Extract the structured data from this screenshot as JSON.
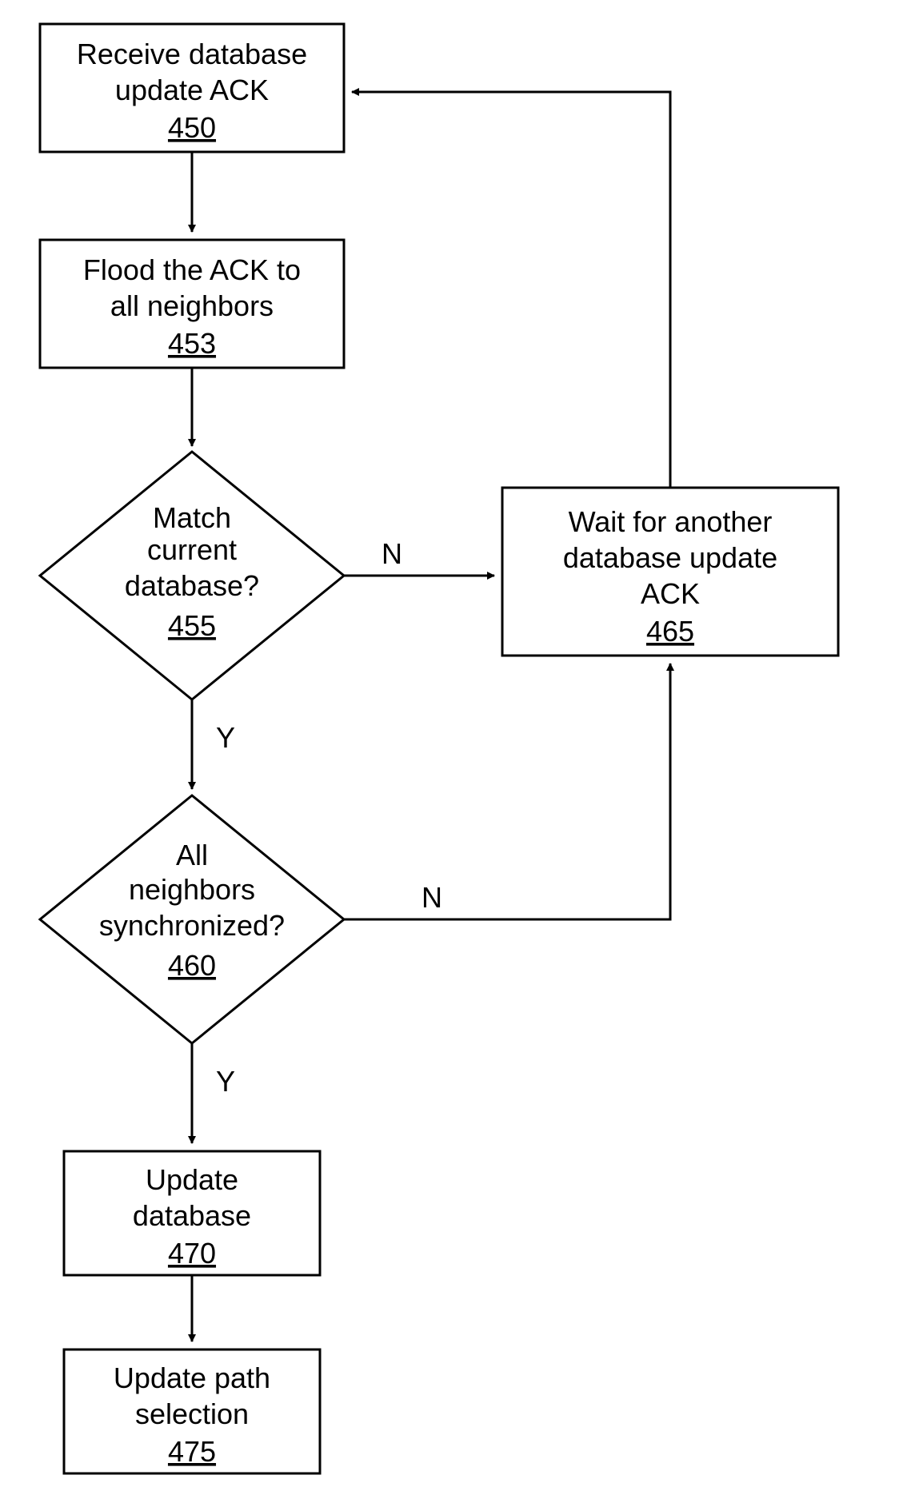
{
  "nodes": {
    "n450": {
      "line1": "Receive database",
      "line2": "update ACK",
      "num": "450"
    },
    "n453": {
      "line1": "Flood the ACK to",
      "line2": "all neighbors",
      "num": "453"
    },
    "n455": {
      "line1": "Match",
      "line2": "current",
      "line3": "database?",
      "num": "455"
    },
    "n460": {
      "line1": "All",
      "line2": "neighbors",
      "line3": "synchronized?",
      "num": "460"
    },
    "n465": {
      "line1": "Wait for another",
      "line2": "database update",
      "line3": "ACK",
      "num": "465"
    },
    "n470": {
      "line1": "Update",
      "line2": "database",
      "num": "470"
    },
    "n475": {
      "line1": "Update path",
      "line2": "selection",
      "num": "475"
    }
  },
  "labels": {
    "yes": "Y",
    "no": "N"
  }
}
